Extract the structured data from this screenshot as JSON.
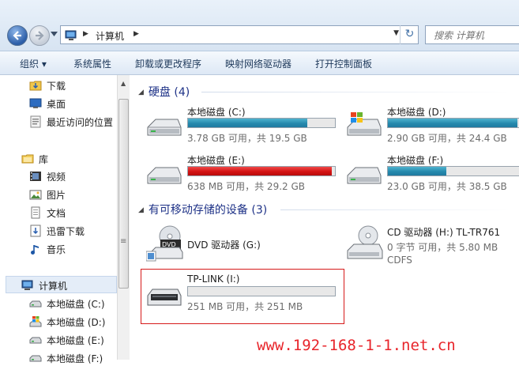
{
  "address": {
    "breadcrumb": "计算机",
    "search_placeholder": "搜索 计算机"
  },
  "toolbar": {
    "organize": "组织 ▾",
    "system_properties": "系统属性",
    "uninstall": "卸载或更改程序",
    "map_drive": "映射网络驱动器",
    "control_panel": "打开控制面板"
  },
  "nav": {
    "favorites": [
      {
        "label": "下载",
        "icon": "download-folder-icon"
      },
      {
        "label": "桌面",
        "icon": "desktop-icon"
      },
      {
        "label": "最近访问的位置",
        "icon": "recent-places-icon"
      }
    ],
    "libraries_label": "库",
    "libraries": [
      {
        "label": "视频",
        "icon": "video-library-icon"
      },
      {
        "label": "图片",
        "icon": "pictures-library-icon"
      },
      {
        "label": "文档",
        "icon": "documents-library-icon"
      },
      {
        "label": "迅雷下载",
        "icon": "thunder-download-icon"
      },
      {
        "label": "音乐",
        "icon": "music-library-icon"
      }
    ],
    "computer_label": "计算机",
    "drives": [
      {
        "label": "本地磁盘 (C:)",
        "icon": "local-disk-icon"
      },
      {
        "label": "本地磁盘 (D:)",
        "icon": "windows-disk-icon"
      },
      {
        "label": "本地磁盘 (E:)",
        "icon": "local-disk-icon"
      },
      {
        "label": "本地磁盘 (F:)",
        "icon": "local-disk-icon"
      }
    ]
  },
  "content": {
    "hard_disks_header": "硬盘 (4)",
    "removable_header": "有可移动存储的设备 (3)",
    "hard_disks": [
      {
        "name": "本地磁盘 (C:)",
        "info": "3.78 GB 可用，共 19.5 GB",
        "used_fraction": 0.81,
        "warn": false
      },
      {
        "name": "本地磁盘 (D:)",
        "info": "2.90 GB 可用，共 24.4 GB",
        "used_fraction": 0.88,
        "warn": false
      },
      {
        "name": "本地磁盘 (E:)",
        "info": "638 MB 可用，共 29.2 GB",
        "used_fraction": 0.98,
        "warn": true
      },
      {
        "name": "本地磁盘 (F:)",
        "info": "23.0 GB 可用，共 38.5 GB",
        "used_fraction": 0.4,
        "warn": false
      }
    ],
    "dvd": {
      "name": "DVD 驱动器 (G:)"
    },
    "cd": {
      "name": "CD 驱动器 (H:) TL-TR761",
      "info": "0 字节 可用，共 5.80 MB",
      "fs": "CDFS"
    },
    "usb": {
      "name": "TP-LINK (I:)",
      "info": "251 MB 可用，共 251 MB",
      "used_fraction": 0.0
    }
  },
  "watermark": "www.192-168-1-1.net.cn",
  "colors": {
    "bar_normal": "#2689ad",
    "bar_warning": "#d41313",
    "highlight_box": "#d61a1a",
    "watermark": "#e8252b"
  }
}
